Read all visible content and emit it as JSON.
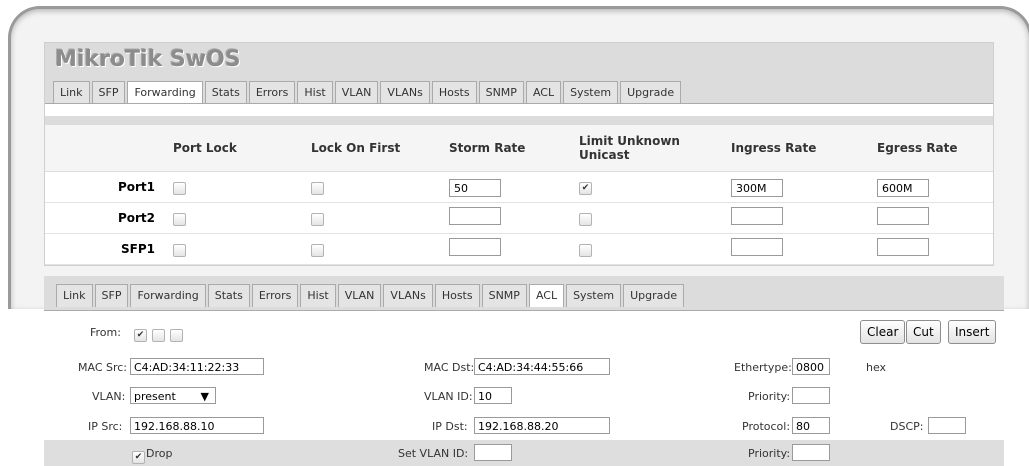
{
  "app": {
    "logo": "MikroTik SwOS"
  },
  "tabs": [
    "Link",
    "SFP",
    "Forwarding",
    "Stats",
    "Errors",
    "Hist",
    "VLAN",
    "VLANs",
    "Hosts",
    "SNMP",
    "ACL",
    "System",
    "Upgrade"
  ],
  "forwarding": {
    "active_tab": "Forwarding",
    "columns": [
      "Port Lock",
      "Lock On First",
      "Storm Rate",
      "Limit Unknown Unicast",
      "Ingress Rate",
      "Egress Rate"
    ],
    "rows": [
      {
        "name": "Port1",
        "port_lock": false,
        "lock_on_first": false,
        "storm_rate": "50",
        "limit_unknown_unicast": true,
        "ingress_rate": "300M",
        "egress_rate": "600M"
      },
      {
        "name": "Port2",
        "port_lock": false,
        "lock_on_first": false,
        "storm_rate": "",
        "limit_unknown_unicast": false,
        "ingress_rate": "",
        "egress_rate": ""
      },
      {
        "name": "SFP1",
        "port_lock": false,
        "lock_on_first": false,
        "storm_rate": "",
        "limit_unknown_unicast": false,
        "ingress_rate": "",
        "egress_rate": ""
      }
    ]
  },
  "acl": {
    "active_tab": "ACL",
    "from_label": "From:",
    "from_checks": [
      true,
      false,
      false
    ],
    "buttons": {
      "clear": "Clear",
      "cut": "Cut",
      "insert": "Insert"
    },
    "mac_src_label": "MAC Src:",
    "mac_src": "C4:AD:34:11:22:33",
    "mac_dst_label": "MAC Dst:",
    "mac_dst": "C4:AD:34:44:55:66",
    "ethertype_label": "Ethertype:",
    "ethertype": "0800",
    "hex_label": "hex",
    "vlan_label": "VLAN:",
    "vlan": "present",
    "vlan_id_label": "VLAN ID:",
    "vlan_id": "10",
    "priority_label": "Priority:",
    "priority": "",
    "ip_src_label": "IP Src:",
    "ip_src": "192.168.88.10",
    "ip_dst_label": "IP Dst:",
    "ip_dst": "192.168.88.20",
    "protocol_label": "Protocol:",
    "protocol": "80",
    "dscp_label": "DSCP:",
    "dscp": "",
    "drop_label": "Drop",
    "drop": true,
    "set_vlan_id_label": "Set VLAN ID:",
    "set_vlan_id": "",
    "priority2_label": "Priority:",
    "priority2": ""
  }
}
